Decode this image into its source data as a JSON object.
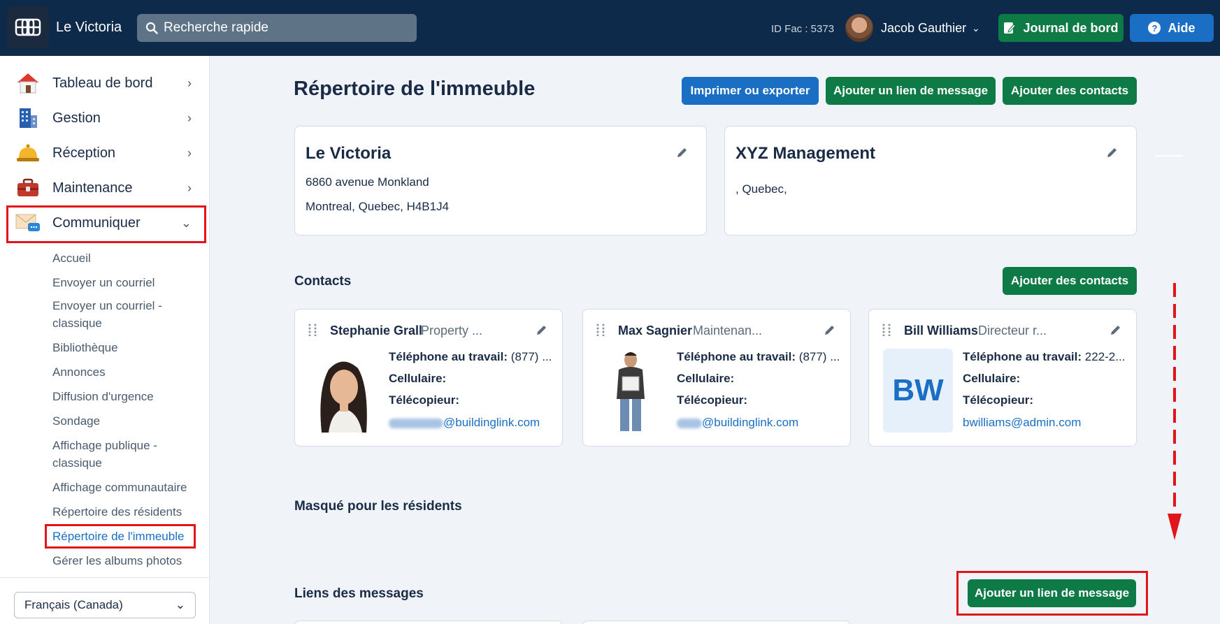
{
  "header": {
    "app_title": "Le Victoria",
    "search_placeholder": "Recherche rapide",
    "fac_id": "ID Fac : 5373",
    "user_name": "Jacob Gauthier",
    "journal_label": "Journal de bord",
    "aide_label": "Aide"
  },
  "sidebar": {
    "items": [
      {
        "label": "Tableau de bord",
        "icon": "house-icon"
      },
      {
        "label": "Gestion",
        "icon": "building-icon"
      },
      {
        "label": "Réception",
        "icon": "bell-icon"
      },
      {
        "label": "Maintenance",
        "icon": "toolbox-icon"
      },
      {
        "label": "Communiquer",
        "icon": "envelope-chat-icon",
        "expanded": true
      }
    ],
    "sub_items": [
      "Accueil",
      "Envoyer un courriel",
      "Envoyer un courriel -",
      "classique",
      "Bibliothèque",
      "Annonces",
      "Diffusion d'urgence",
      "Sondage",
      "Affichage publique -",
      "classique",
      "Affichage communautaire",
      "Répertoire des résidents",
      "Répertoire de l'immeuble",
      "Gérer les albums photos"
    ],
    "language": "Français (Canada)"
  },
  "main": {
    "title": "Répertoire de l'immeuble",
    "btn_print": "Imprimer ou exporter",
    "btn_add_link": "Ajouter un lien de message",
    "btn_add_contacts": "Ajouter des contacts",
    "building_card": {
      "name": "Le Victoria",
      "address1": "6860 avenue Monkland",
      "address2": "Montreal, Quebec, H4B1J4"
    },
    "management_card": {
      "name": "XYZ Management",
      "address1": ", Quebec,"
    },
    "contacts_title": "Contacts",
    "contacts_add": "Ajouter des contacts",
    "labels": {
      "work_phone": "Téléphone au travail:",
      "cell": "Cellulaire:",
      "fax": "Télécopieur:"
    },
    "contacts": [
      {
        "name": "Stephanie Grall",
        "role": "Property ...",
        "work_phone": "(877) ...",
        "email_domain": "@buildinglink.com"
      },
      {
        "name": "Max Sagnier",
        "role": "Maintenan...",
        "work_phone": "(877) ...",
        "email_domain": "@buildinglink.com"
      },
      {
        "name": "Bill Williams",
        "role": "Directeur r...",
        "work_phone": "222-2...",
        "email": "bwilliams@admin.com",
        "initials": "BW"
      }
    ],
    "hidden_title": "Masqué pour les résidents",
    "links_title": "Liens des messages",
    "links_add": "Ajouter un lien de message"
  },
  "colors": {
    "header_bg": "#0d2a4b",
    "accent_blue": "#1a6fc4",
    "accent_green": "#0e7a45",
    "highlight_red": "#e0161b"
  }
}
